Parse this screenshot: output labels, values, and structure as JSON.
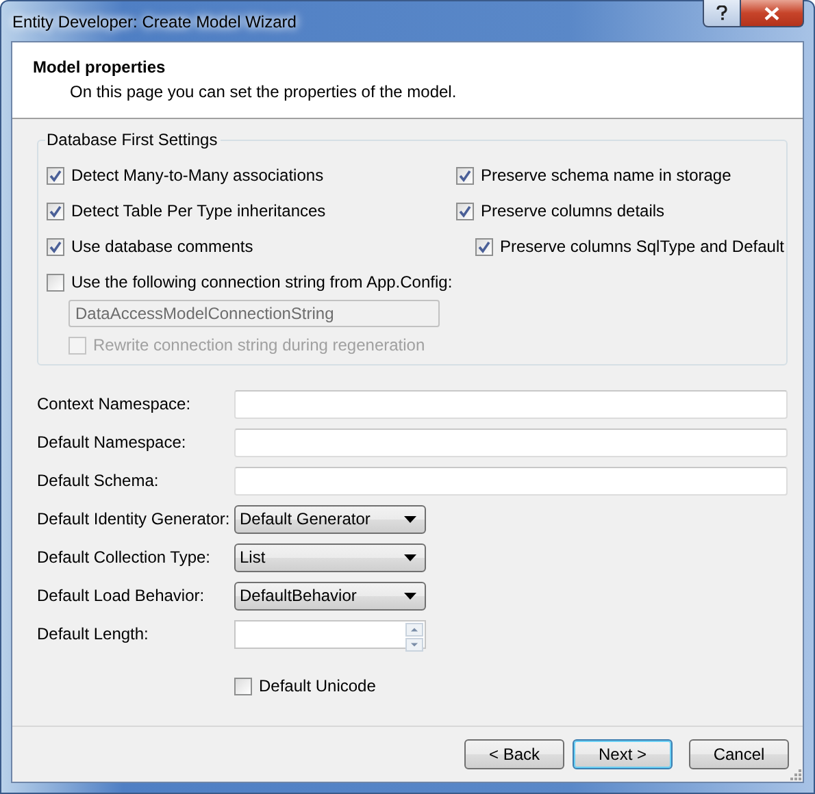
{
  "window": {
    "title": "Entity Developer: Create Model Wizard"
  },
  "header": {
    "title": "Model properties",
    "subtitle": "On this page you can set the properties of the model."
  },
  "settings_group": {
    "title": "Database First Settings",
    "left_options": [
      {
        "label": "Detect Many-to-Many associations",
        "checked": true
      },
      {
        "label": "Detect Table Per Type inheritances",
        "checked": true
      },
      {
        "label": "Use database comments",
        "checked": true
      }
    ],
    "connection_option": {
      "label": "Use the following connection string from App.Config:",
      "checked": false
    },
    "connection_string": {
      "value": "DataAccessModelConnectionString",
      "disabled": true
    },
    "rewrite_option": {
      "label": "Rewrite connection string during regeneration",
      "checked": false,
      "disabled": true
    },
    "right_options": [
      {
        "label": "Preserve schema name in storage",
        "checked": true
      },
      {
        "label": "Preserve columns details",
        "checked": true,
        "children": [
          {
            "label": "Preserve columns SqlType and Default",
            "checked": true
          }
        ]
      }
    ]
  },
  "fields": [
    {
      "kind": "text",
      "label": "Context Namespace:"
    },
    {
      "kind": "text",
      "label": "Default Namespace:"
    },
    {
      "kind": "text",
      "label": "Default Schema:"
    },
    {
      "kind": "combo",
      "label": "Default Identity Generator:",
      "value": "Default Generator"
    },
    {
      "kind": "combo",
      "label": "Default Collection Type:",
      "value": "List"
    },
    {
      "kind": "combo",
      "label": "Default Load Behavior:",
      "value": "DefaultBehavior"
    },
    {
      "kind": "spin",
      "label": "Default Length:"
    },
    {
      "kind": "checkbox",
      "label": "Default Unicode",
      "checked": false
    }
  ],
  "buttons": [
    {
      "label": "< Back",
      "default": false
    },
    {
      "label": "Next >",
      "default": true
    },
    {
      "label": "Cancel",
      "default": false
    }
  ]
}
